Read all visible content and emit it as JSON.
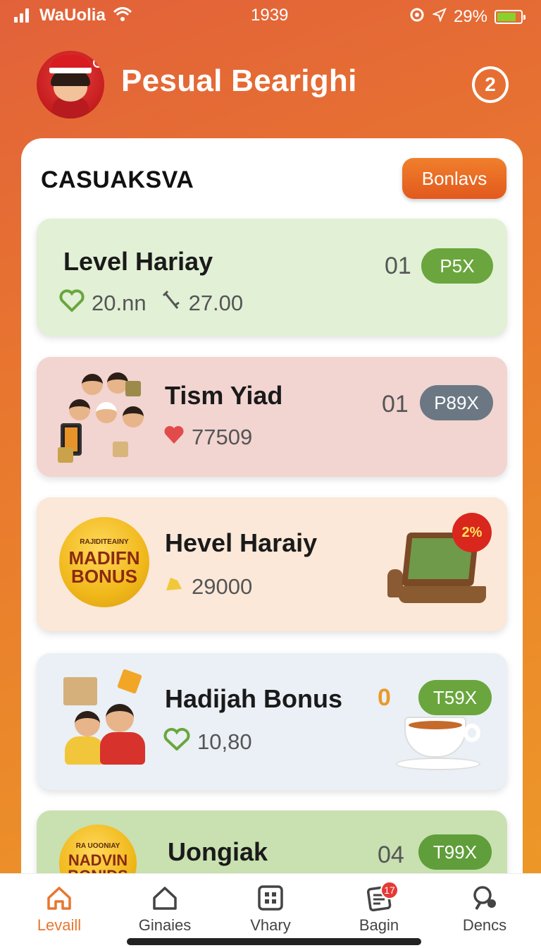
{
  "status": {
    "carrier": "WaUolia",
    "time": "1939",
    "battery": "29%"
  },
  "header": {
    "title": "Pesual Bearighi",
    "help_label": "2"
  },
  "panel": {
    "title": "CASUAKSVA",
    "bonus_button": "Bonlavs"
  },
  "cards": [
    {
      "title": "Level Hariay",
      "stat1": "20.nn",
      "stat2": "27.00",
      "count": "01",
      "pill": "P5X",
      "pill_color": "#6aa63d"
    },
    {
      "title": "Tism Yiad",
      "stat1": "77509",
      "count": "01",
      "pill": "P89X",
      "pill_color": "#6b7883"
    },
    {
      "title": "Hevel Haraiy",
      "stat1": "29000",
      "badge_small": "RAJIDITEAINY",
      "badge_big": "MADIFN BONUS",
      "corner_badge": "2%"
    },
    {
      "title": "Hadijah Bonus",
      "stat1": "10,80",
      "count": "0",
      "pill": "T59X",
      "pill_color": "#6aa63d"
    },
    {
      "title": "Uongiak",
      "count": "04",
      "pill": "T99X",
      "pill_color": "#5f9e3a",
      "badge_small": "RA UOONIAY",
      "badge_big": "NADVIN BONIDS"
    }
  ],
  "tabs": [
    {
      "label": "Levaill",
      "icon": "home-icon",
      "active": true
    },
    {
      "label": "Ginaies",
      "icon": "house-outline-icon"
    },
    {
      "label": "Vhary",
      "icon": "grid-icon"
    },
    {
      "label": "Bagin",
      "icon": "document-icon",
      "badge": "17"
    },
    {
      "label": "Dencs",
      "icon": "search-person-icon"
    }
  ],
  "colors": {
    "accent": "#e8762f",
    "green": "#6aa63d"
  }
}
